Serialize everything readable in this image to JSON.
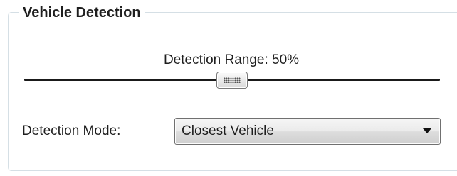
{
  "group": {
    "title": "Vehicle Detection"
  },
  "range": {
    "label": "Detection Range: 50%",
    "value_fraction": 0.5
  },
  "mode": {
    "label": "Detection Mode:",
    "selected": "Closest Vehicle",
    "icon": "chevron-down-icon"
  }
}
